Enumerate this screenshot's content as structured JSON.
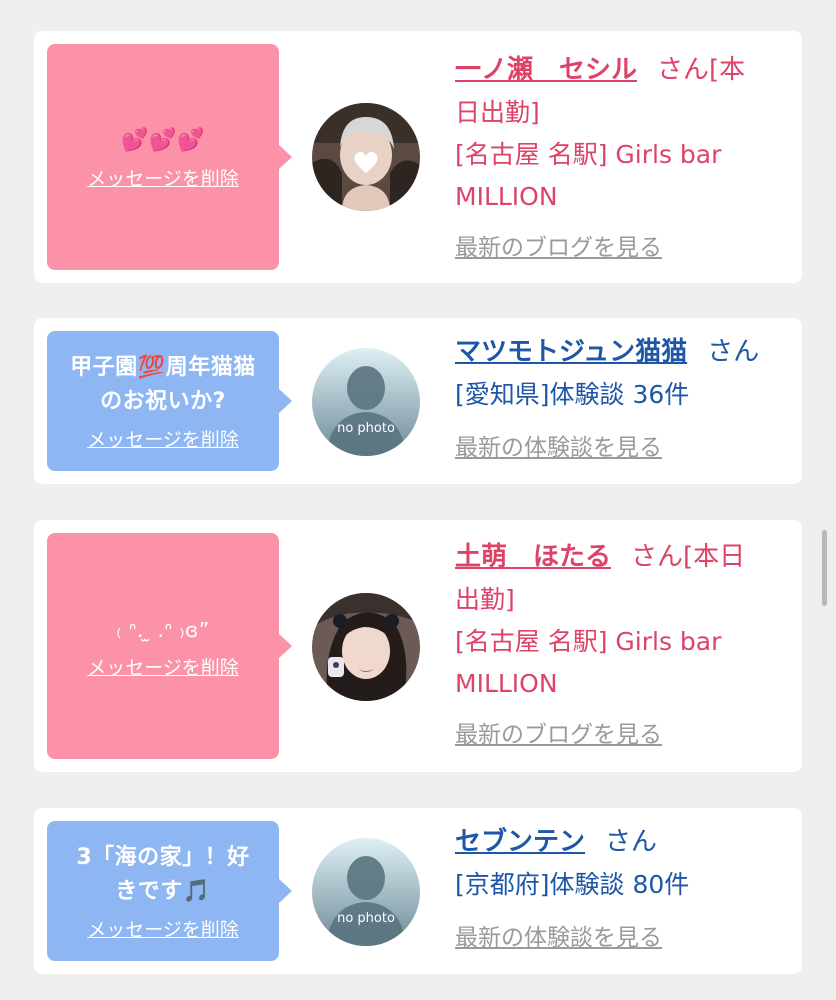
{
  "cards": [
    {
      "bubble_color": "#fb92a7",
      "message": "💕💕💕",
      "delete_label": "メッセージを削除",
      "avatar_icon": "photo-avatar-heart-sticker",
      "name": "一ノ瀬　セシル",
      "honorific_lines": [
        "さん[本",
        "日出勤]"
      ],
      "shop_lines": [
        "[名古屋 名駅] Girls bar",
        "MILLION"
      ],
      "more_label": "最新のブログを見る"
    },
    {
      "bubble_color": "#8db6f3",
      "message_lines": [
        "甲子園💯周年猫猫",
        "のお祝いか?"
      ],
      "delete_label": "メッセージを削除",
      "avatar_icon": "no-photo-silhouette",
      "avatar_caption": "no photo",
      "name": "マツモトジュン猫猫",
      "honorific": "さん",
      "detail": "[愛知県]体験談 36件",
      "more_label": "最新の体験談を見る"
    },
    {
      "bubble_color": "#fb92a7",
      "message": "₍ ᐢ. ̫ .ᐢ ₎ɞ”",
      "delete_label": "メッセージを削除",
      "avatar_icon": "photo-avatar-girl",
      "name": "土萌　ほたる",
      "honorific_lines": [
        "さん[本日",
        "出勤]"
      ],
      "shop_lines": [
        "[名古屋 名駅] Girls bar",
        "MILLION"
      ],
      "more_label": "最新のブログを見る"
    },
    {
      "bubble_color": "#8db6f3",
      "message_lines": [
        "3「海の家」！好",
        "きです🎵"
      ],
      "delete_label": "メッセージを削除",
      "avatar_icon": "no-photo-silhouette",
      "avatar_caption": "no photo",
      "name": "セブンテン",
      "honorific": "さん",
      "detail": "[京都府]体験談 80件",
      "more_label": "最新の体験談を見る"
    }
  ]
}
